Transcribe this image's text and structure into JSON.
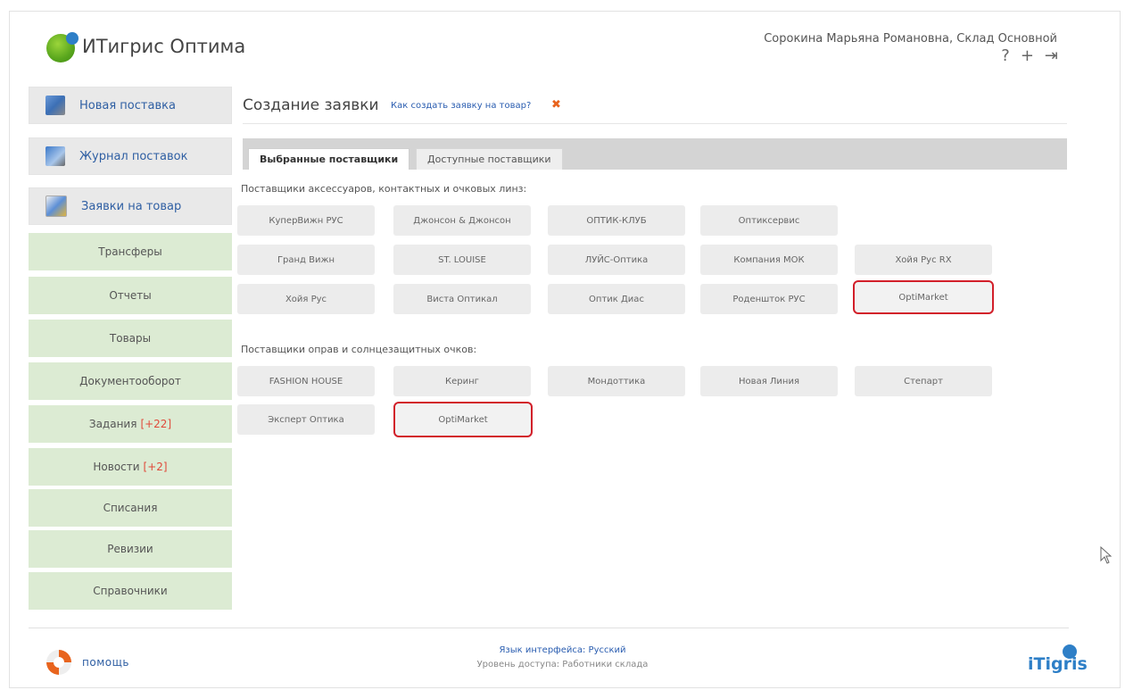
{
  "header": {
    "app_title": "ИТигрис Оптима",
    "user_info": "Сорокина Марьяна Романовна, Склад Основной",
    "icons": [
      "help-icon",
      "add-icon",
      "logout-icon"
    ],
    "icon_glyphs": {
      "help": "?",
      "add": "+",
      "logout": "⇥"
    }
  },
  "sidebar": {
    "icon_items": [
      {
        "label": "Новая поставка",
        "icon": "truck-icon"
      },
      {
        "label": "Журнал поставок",
        "icon": "journal-icon"
      },
      {
        "label": "Заявки на товар",
        "icon": "order-icon"
      }
    ],
    "items": [
      {
        "label": "Трансферы",
        "badge": ""
      },
      {
        "label": "Отчеты",
        "badge": ""
      },
      {
        "label": "Товары",
        "badge": ""
      },
      {
        "label": "Документооборот",
        "badge": ""
      },
      {
        "label": "Задания",
        "badge": "[+22]"
      },
      {
        "label": "Новости",
        "badge": "[+2]"
      },
      {
        "label": "Списания",
        "badge": ""
      },
      {
        "label": "Ревизии",
        "badge": ""
      },
      {
        "label": "Справочники",
        "badge": ""
      }
    ]
  },
  "main": {
    "title": "Создание заявки",
    "help_link": "Как создать заявку на товар?",
    "close_glyph": "✖",
    "tabs": [
      {
        "label": "Выбранные поставщики",
        "active": true
      },
      {
        "label": "Доступные поставщики",
        "active": false
      }
    ],
    "section1_label": "Поставщики аксессуаров, контактных и очковых линз:",
    "section1_suppliers": [
      [
        "КуперВижн РУС",
        "Джонсон & Джонсон",
        "ОПТИК-КЛУБ",
        "Оптиксервис"
      ],
      [
        "Гранд Вижн",
        "ST. LOUISE",
        "ЛУЙС-Оптика",
        "Компания МОК",
        "Хойя Рус RX"
      ],
      [
        "Хойя Рус",
        "Виста Оптикал",
        "Оптик Диас",
        "Роденшток РУС",
        "OptiMarket"
      ]
    ],
    "section2_label": "Поставщики оправ и солнцезащитных очков:",
    "section2_suppliers": [
      [
        "FASHION HOUSE",
        "Керинг",
        "Мондоттика",
        "Новая Линия",
        "Степарт"
      ],
      [
        "Эксперт Оптика",
        "OptiMarket"
      ]
    ],
    "highlight_color": "#d21f2a"
  },
  "footer": {
    "help_label": "помощь",
    "language": "Язык интерфейса: Русский",
    "access_level": "Уровень доступа: Работники склада",
    "brand": "iTigris"
  }
}
